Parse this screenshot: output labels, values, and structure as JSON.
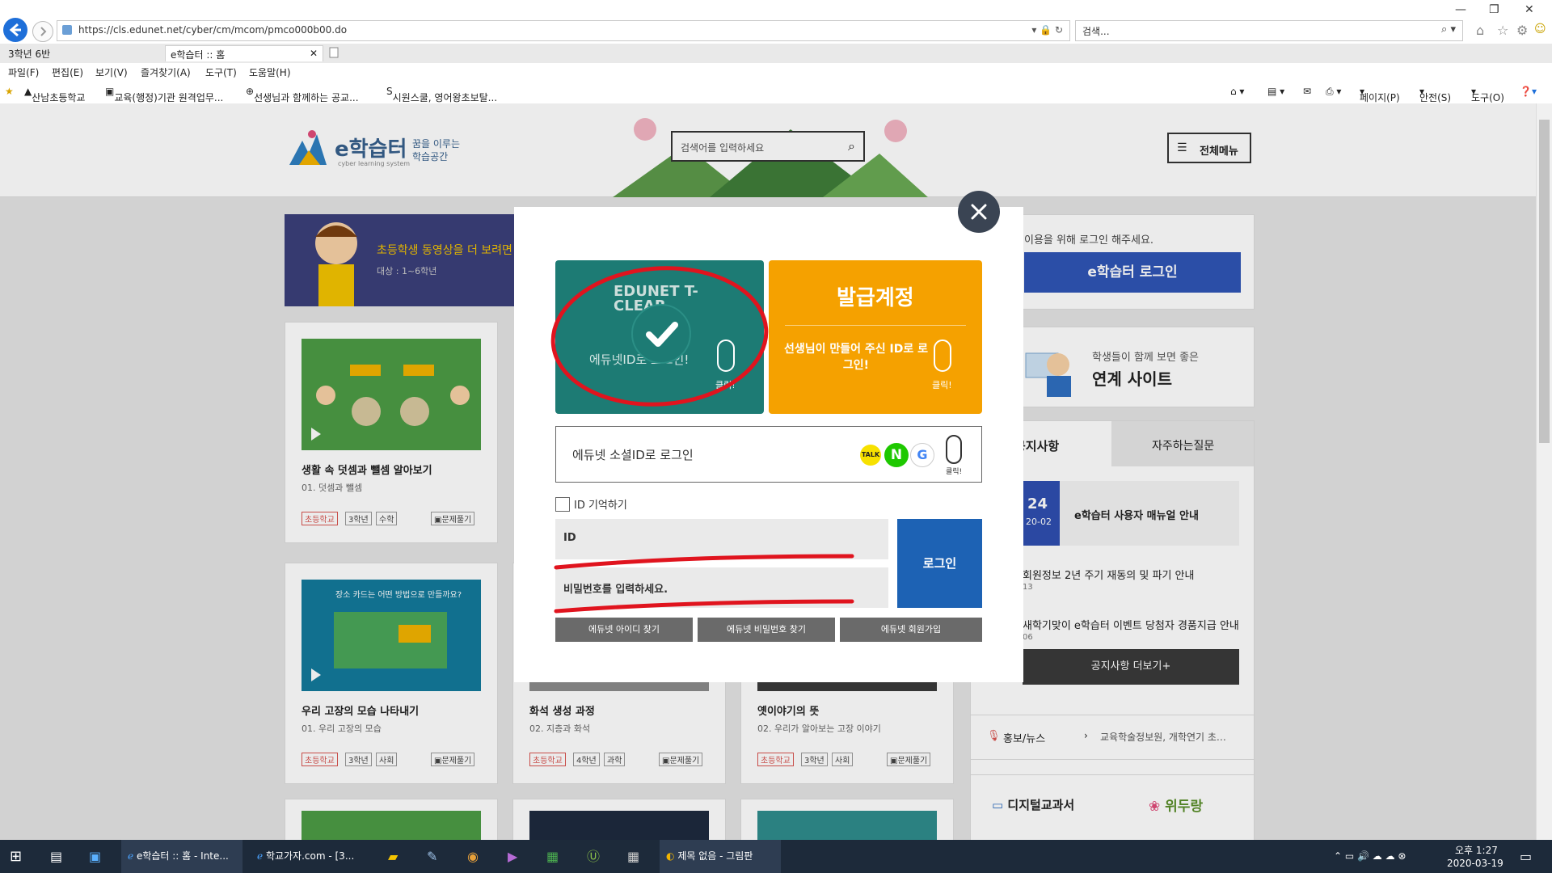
{
  "browser": {
    "url": "https://cls.edunet.net/cyber/cm/mcom/pmco000b00.do",
    "search_placeholder": "검색...",
    "tabs": [
      {
        "label": "3학년 6반"
      },
      {
        "label": "e학습터 :: 홈"
      }
    ],
    "menu": [
      "파일(F)",
      "편집(E)",
      "보기(V)",
      "즐겨찾기(A)",
      "도구(T)",
      "도움말(H)"
    ],
    "favorites": [
      "산남초등학교",
      "교육(행정)기관 원격업무...",
      "선생님과 함께하는 공교...",
      "시원스쿨, 영어왕초보탈..."
    ],
    "commandbar": [
      "페이지(P)",
      "안전(S)",
      "도구(O)"
    ]
  },
  "site": {
    "logo_text": "e학습터",
    "logo_slogan": "꿈을 이루는 학습공간",
    "logo_sub": "cyber learning system",
    "search_placeholder": "검색어를 입력하세요",
    "menu_label": "전체메뉴",
    "banner_title": "초등학생 동영상을 더 보려면",
    "banner_sub": "대상 : 1~6학년",
    "login_notice": "이용을 위해 로그인 해주세요.",
    "login_button": "e학습터 로그인",
    "linked_site_small": "학생들이 함께 보면 좋은",
    "linked_site_big": "연계 사이트",
    "notice_tab": "공지사항",
    "faq_tab": "자주하는질문",
    "notices": [
      {
        "date_top": "24",
        "date_bottom": "20-02",
        "title": "e학습터 사용자 매뉴얼 안내"
      },
      {
        "title": "회원정보 2년 주기 재동의 및 파기 안내",
        "date": "13"
      },
      {
        "title": "새학기맞이 e학습터 이벤트 당첨자 경품지급 안내",
        "date": "06"
      }
    ],
    "notice_more": "공지사항 더보기+",
    "news_label": "홍보/뉴스",
    "news_text": "교육학술정보원, 개학연기 초…",
    "digital_textbook": "디지털교과서",
    "wedorang": "위두랑",
    "cards": [
      {
        "title": "생활 속 덧셈과 뺄셈 알아보기",
        "sub": "01. 덧셈과 뺄셈",
        "tags": [
          "초등학교",
          "3학년",
          "수학"
        ],
        "btn": "문제풀기"
      },
      {
        "title": "우리 고장의 모습 나타내기",
        "sub": "01. 우리 고장의 모습",
        "tags": [
          "초등학교",
          "3학년",
          "사회"
        ],
        "btn": "문제풀기",
        "thumb_text": "장소 카드는 어떤 방법으로 만들까요?"
      },
      {
        "title": "화석 생성 과정",
        "sub": "02. 지층과 화석",
        "tags": [
          "초등학교",
          "4학년",
          "과학"
        ],
        "btn": "문제풀기"
      },
      {
        "title": "옛이야기의 뜻",
        "sub": "02. 우리가 알아보는 고장 이야기",
        "tags": [
          "초등학교",
          "3학년",
          "사회"
        ],
        "btn": "문제풀기"
      }
    ]
  },
  "modal": {
    "tclear_brand": "EDUNET T-CLEAR",
    "tclear_label": "에듀넷ID로 로그인!",
    "click_label": "클릭!",
    "issued_title": "발급계정",
    "issued_desc": "선생님이 만들어 주신 ID로 로그인!",
    "social_label": "에듀넷 소셜ID로 로그인",
    "remember_label": "ID 기억하기",
    "id_placeholder": "ID",
    "pw_placeholder": "비밀번호를 입력하세요.",
    "login_button": "로그인",
    "find_id": "에듀넷 아이디 찾기",
    "find_pw": "에듀넷 비밀번호 찾기",
    "signup": "에듀넷 회원가입"
  },
  "taskbar": {
    "items": [
      "e학습터 :: 홈 - Inte...",
      "학교가자.com - [3...",
      "제목 없음 - 그림판"
    ],
    "time": "오후 1:27",
    "date": "2020-03-19"
  },
  "colors": {
    "teal": "#1d7b74",
    "orange": "#f5a100",
    "login_blue": "#1d62b4",
    "annotation_red": "#e0141e"
  }
}
